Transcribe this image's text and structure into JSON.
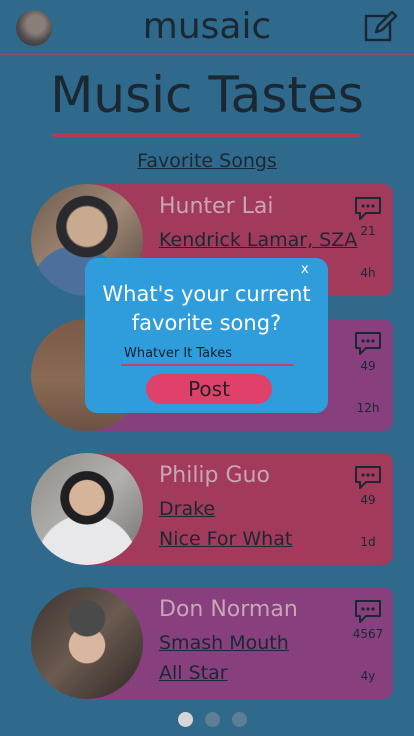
{
  "header": {
    "app_title": "musaic"
  },
  "page": {
    "title": "Music Tastes",
    "section_link": "Favorite Songs"
  },
  "cards": [
    {
      "name": "Hunter Lai",
      "artist": "Kendrick Lamar, SZA",
      "song": "",
      "comment_count": "21",
      "age": "4h"
    },
    {
      "name": "",
      "artist": "",
      "song": "",
      "comment_count": "49",
      "age": "12h"
    },
    {
      "name": "Philip Guo",
      "artist": "Drake",
      "song": "Nice For What",
      "comment_count": "49",
      "age": "1d"
    },
    {
      "name": "Don Norman",
      "artist": "Smash Mouth",
      "song": "All Star",
      "comment_count": "4567",
      "age": "4y"
    }
  ],
  "modal": {
    "close": "x",
    "question": "What's your current favorite song?",
    "input_value": "Whatver It Takes",
    "post_label": "Post"
  },
  "pagination": {
    "pages": 3,
    "current": 1
  },
  "colors": {
    "background": "#2f6a8d",
    "card_red": "#a13a5b",
    "card_purple": "#873f7e",
    "modal": "#2f9ddc",
    "post_button": "#e0416b"
  },
  "icons": {
    "edit": "edit-icon",
    "comment": "comment-icon"
  }
}
